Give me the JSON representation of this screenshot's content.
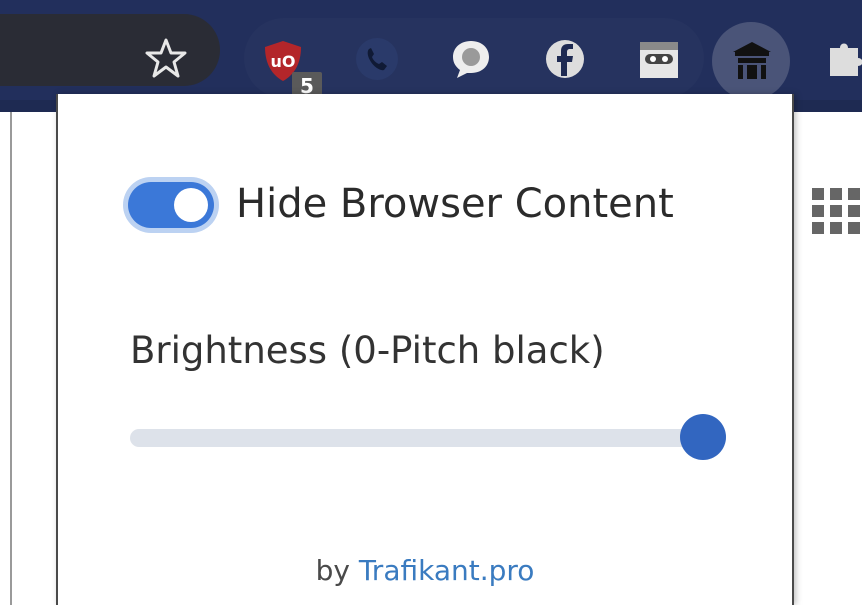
{
  "toolbar": {
    "extensions": [
      {
        "name": "ublock-origin",
        "icon": "ublock-shield-icon",
        "badge": "5",
        "color": "#b3262a"
      },
      {
        "name": "call",
        "icon": "phone-icon",
        "color": "#1a2a52"
      },
      {
        "name": "chat-bubble",
        "icon": "chat-bubble-icon",
        "color": "#eeeeee"
      },
      {
        "name": "facebook",
        "icon": "facebook-icon",
        "color": "#dddddd"
      },
      {
        "name": "ninja-mask",
        "icon": "ninja-mask-icon",
        "color": "#e6e6e6"
      },
      {
        "name": "privacy-extension",
        "icon": "temple-icon",
        "color": "#111111",
        "active": true
      },
      {
        "name": "extensions-menu",
        "icon": "puzzle-icon",
        "color": "#dddddd"
      }
    ],
    "bookmark_icon": "star-icon"
  },
  "page": {
    "apps_icon": "apps-grid-icon"
  },
  "popup": {
    "toggle": {
      "label": "Hide Browser Content",
      "checked": true,
      "accent": "#3b78d8"
    },
    "brightness": {
      "label": "Brightness (0-Pitch black)",
      "min": 0,
      "max": 100,
      "value": 100,
      "accent": "#3266c0"
    },
    "footer": {
      "prefix": "by",
      "link_text": "Trafikant.pro",
      "link_color": "#3a7bc0"
    }
  }
}
